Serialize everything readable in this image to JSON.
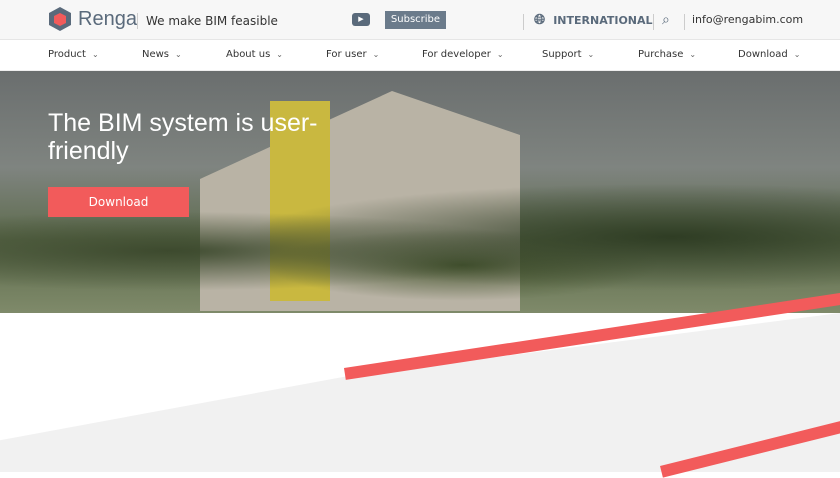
{
  "header": {
    "brand": "Renga",
    "tagline": "We make BIM feasible",
    "subscribe": "Subscribe",
    "region": "INTERNATIONAL",
    "email": "info@rengabim.com"
  },
  "nav": [
    "Product",
    "News",
    "About us",
    "For user",
    "For developer",
    "Support",
    "Purchase",
    "Download"
  ],
  "hero": {
    "title": "The BIM system is user-friendly",
    "cta": "Download"
  },
  "colors": {
    "accent": "#f25b5b",
    "brand": "#5a6a7b"
  }
}
